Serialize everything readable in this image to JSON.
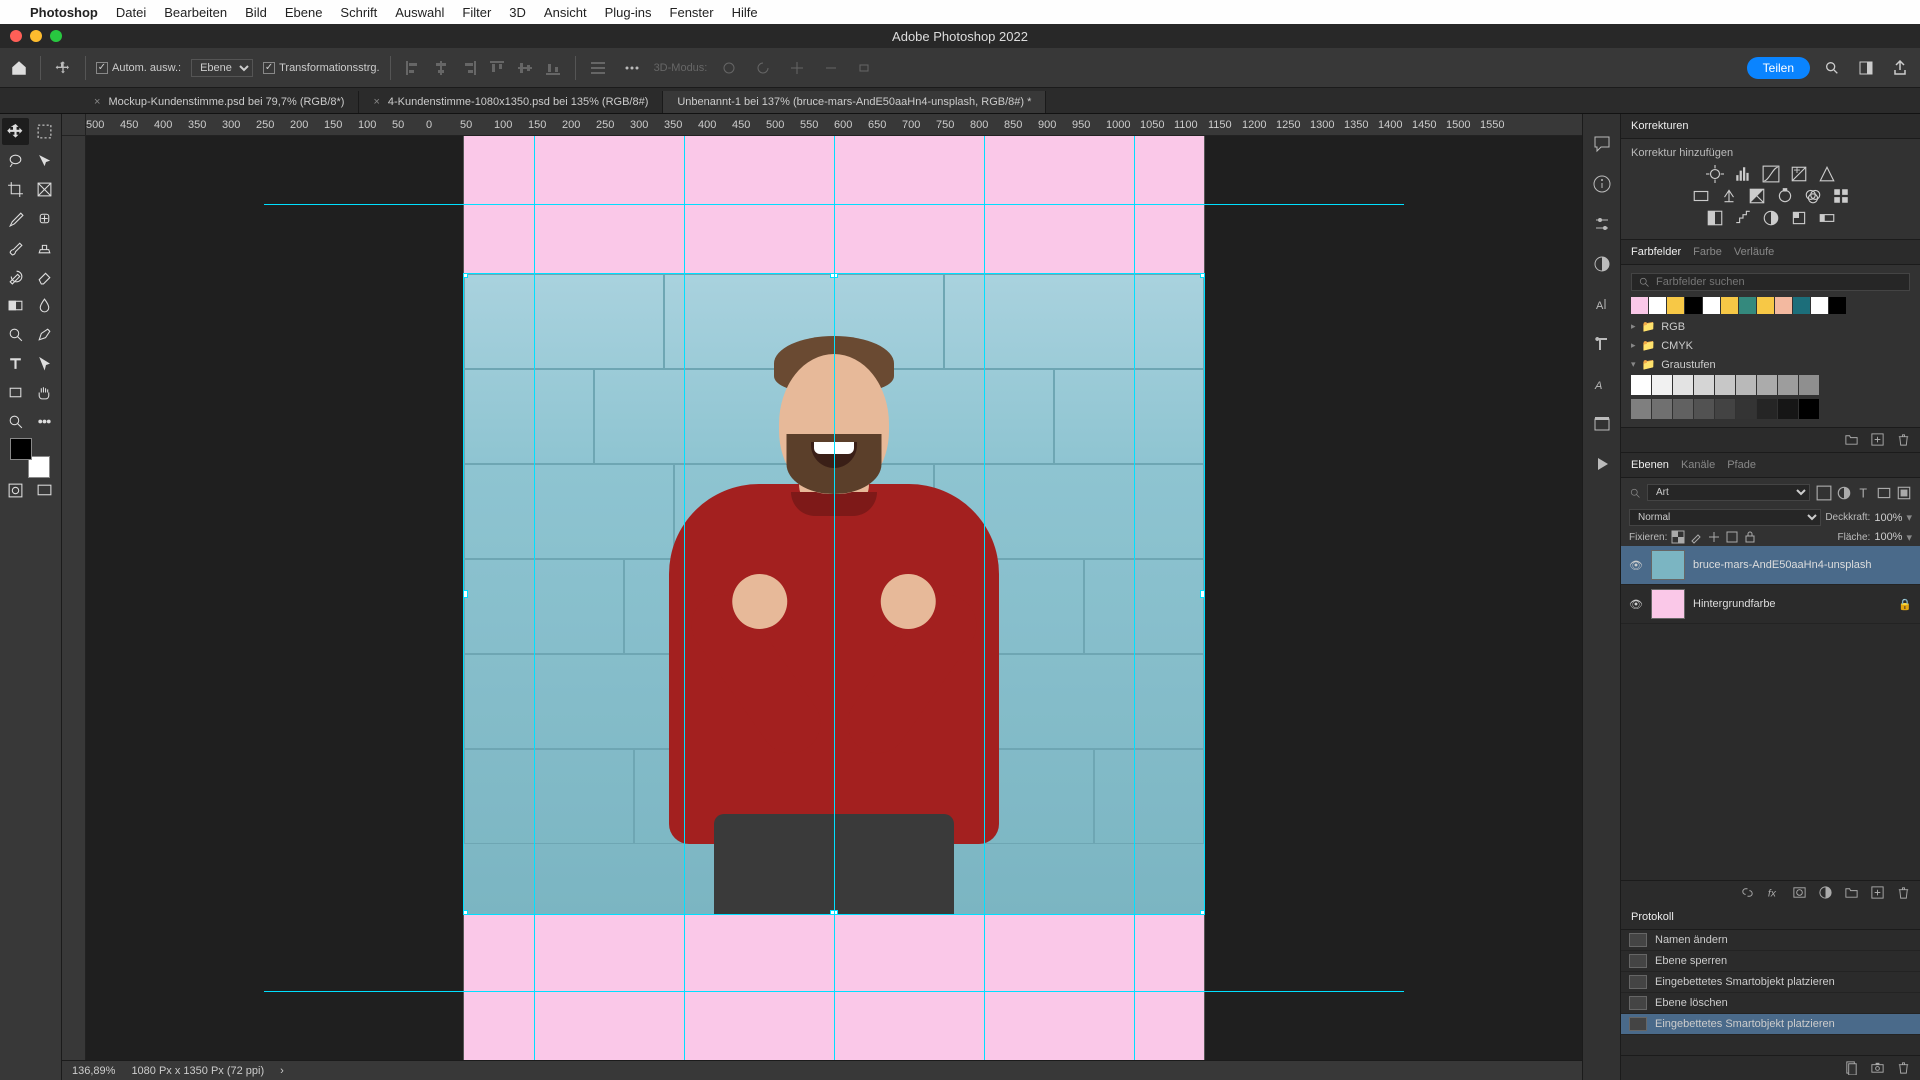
{
  "menubar": {
    "app": "Photoshop",
    "items": [
      "Datei",
      "Bearbeiten",
      "Bild",
      "Ebene",
      "Schrift",
      "Auswahl",
      "Filter",
      "3D",
      "Ansicht",
      "Plug-ins",
      "Fenster",
      "Hilfe"
    ]
  },
  "app_title": "Adobe Photoshop 2022",
  "options_bar": {
    "auto_select_label": "Autom. ausw.:",
    "auto_select_target": "Ebene",
    "transform_label": "Transformationsstrg.",
    "mode3d_label": "3D-Modus:",
    "share_label": "Teilen"
  },
  "tabs": [
    {
      "label": "Mockup-Kundenstimme.psd bei 79,7% (RGB/8*)",
      "active": false
    },
    {
      "label": "4-Kundenstimme-1080x1350.psd bei 135% (RGB/8#)",
      "active": false
    },
    {
      "label": "Unbenannt-1 bei 137% (bruce-mars-AndE50aaHn4-unsplash, RGB/8#) *",
      "active": true
    }
  ],
  "ruler_ticks": [
    "500",
    "450",
    "400",
    "350",
    "300",
    "250",
    "200",
    "150",
    "100",
    "50",
    "0",
    "50",
    "100",
    "150",
    "200",
    "250",
    "300",
    "350",
    "400",
    "450",
    "500",
    "550",
    "600",
    "650",
    "700",
    "750",
    "800",
    "850",
    "900",
    "950",
    "1000",
    "1050",
    "1100",
    "1150",
    "1200",
    "1250",
    "1300",
    "1350",
    "1400",
    "1450",
    "1500",
    "1550"
  ],
  "status": {
    "zoom": "136,89%",
    "doc": "1080 Px x 1350 Px (72 ppi)",
    "arrow": "›"
  },
  "adjustments": {
    "tab": "Korrekturen",
    "hint": "Korrektur hinzufügen"
  },
  "swatches": {
    "tabs": [
      "Farbfelder",
      "Farbe",
      "Verläufe"
    ],
    "search_placeholder": "Farbfelder suchen",
    "top_row": [
      "#fac8e8",
      "#ffffff",
      "#f7c846",
      "#000000",
      "#ffffff",
      "#f7c846",
      "#34897d",
      "#f7c846",
      "#f3b9a0",
      "#1c6e7a",
      "#ffffff",
      "#000000"
    ],
    "folders": [
      {
        "open": false,
        "name": "RGB"
      },
      {
        "open": false,
        "name": "CMYK"
      },
      {
        "open": true,
        "name": "Graustufen"
      }
    ],
    "grays_row1": [
      "#ffffff",
      "#f1f1f1",
      "#e3e3e3",
      "#d5d5d5",
      "#c7c7c7",
      "#b9b9b9",
      "#ababab",
      "#9d9d9d",
      "#8f8f8f"
    ],
    "grays_row2": [
      "#7f7f7f",
      "#707070",
      "#616161",
      "#525252",
      "#434343",
      "#343434",
      "#252525",
      "#161616",
      "#000000"
    ]
  },
  "layers_panel": {
    "tabs": [
      "Ebenen",
      "Kanäle",
      "Pfade"
    ],
    "kind_label": "Art",
    "blend_mode": "Normal",
    "opacity_label": "Deckkraft:",
    "opacity_value": "100%",
    "lock_label": "Fixieren:",
    "fill_label": "Fläche:",
    "fill_value": "100%",
    "layers": [
      {
        "name": "bruce-mars-AndE50aaHn4-unsplash",
        "selected": true,
        "visible": true,
        "locked": false,
        "thumb": "#7bb5c2"
      },
      {
        "name": "Hintergrundfarbe",
        "selected": false,
        "visible": true,
        "locked": true,
        "thumb": "#fac8e8"
      }
    ]
  },
  "history_panel": {
    "tab": "Protokoll",
    "items": [
      {
        "label": "Namen ändern",
        "selected": false
      },
      {
        "label": "Ebene sperren",
        "selected": false
      },
      {
        "label": "Eingebettetes Smartobjekt platzieren",
        "selected": false
      },
      {
        "label": "Ebene löschen",
        "selected": false
      },
      {
        "label": "Eingebettetes Smartobjekt platzieren",
        "selected": true
      }
    ]
  }
}
